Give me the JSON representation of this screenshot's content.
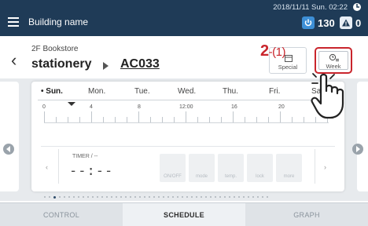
{
  "header": {
    "title": "Building name",
    "datetime": "2018/11/11 Sun. 02:22",
    "count_on": "130",
    "count_alert": "0"
  },
  "breadcrumb": {
    "floor": "2F Bookstore",
    "group": "stationery",
    "unit": "AC033"
  },
  "mode_buttons": {
    "special": "Special",
    "week": "Week"
  },
  "annotation": {
    "step_main": "2",
    "step_sub": "-(1)"
  },
  "schedule": {
    "days": [
      "• Sun.",
      "Mon.",
      "Tue.",
      "Wed.",
      "Thu.",
      "Fri.",
      "Sat."
    ],
    "selected_day": "Sun.",
    "time_ticks": [
      "0",
      "4",
      "8",
      "12:00",
      "16",
      "20",
      "24"
    ],
    "timer_label": "TIMER / --",
    "timer_value": "--:--",
    "nav_left": "‹",
    "nav_right": "›",
    "controls": [
      "ON/OFF",
      "mode",
      "temp.",
      "lock",
      "more"
    ]
  },
  "tabs": {
    "control": "CONTROL",
    "schedule": "SCHEDULE",
    "graph": "GRAPH",
    "active": "SCHEDULE"
  },
  "colors": {
    "header_bg": "#1f3b57",
    "accent_red": "#c9252c",
    "power_blue": "#3d8fd6"
  }
}
